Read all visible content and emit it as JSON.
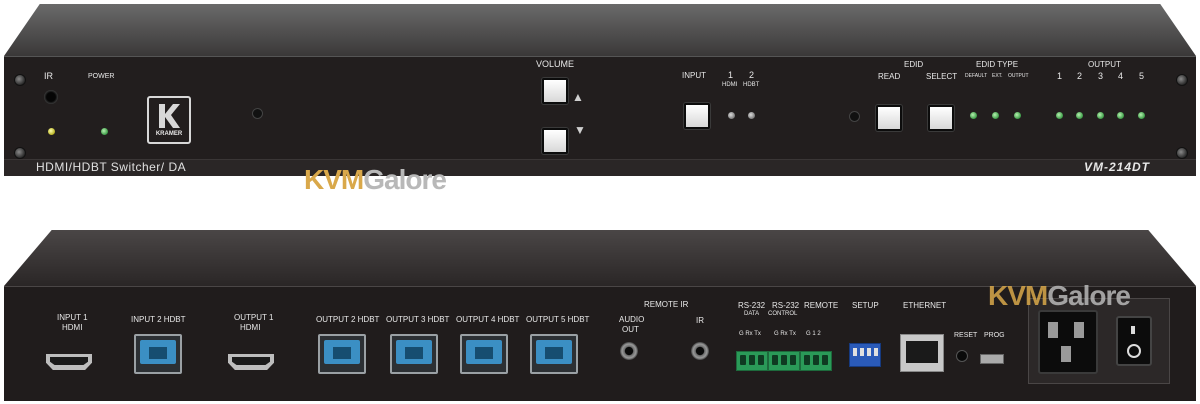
{
  "front_panel": {
    "labels": {
      "ir": "IR",
      "power": "POWER",
      "volume": "VOLUME",
      "input": "INPUT",
      "input_1": "1",
      "input_2": "2",
      "hdmi": "HDMI",
      "hdbt": "HDBT",
      "edid": "EDID",
      "read": "READ",
      "select": "SELECT",
      "edid_type": "EDID TYPE",
      "default": "DEFAULT",
      "ext": "EXT.",
      "output": "OUTPUT",
      "outputs_header": "OUTPUT",
      "output_numbers": [
        "1",
        "2",
        "3",
        "4",
        "5"
      ]
    },
    "logo_text": "KRAMER",
    "product_description": "HDMI/HDBT Switcher/ DA",
    "model": "VM-214DT",
    "arrows": {
      "up": "▲",
      "down": "▼"
    }
  },
  "rear_panel": {
    "labels": {
      "input_1": "INPUT 1",
      "input_1_sub": "HDMI",
      "input_2": "INPUT 2 HDBT",
      "output_1": "OUTPUT 1",
      "output_1_sub": "HDMI",
      "output_2": "OUTPUT 2 HDBT",
      "output_3": "OUTPUT 3 HDBT",
      "output_4": "OUTPUT 4 HDBT",
      "output_5": "OUTPUT 5 HDBT",
      "remote_ir": "REMOTE IR",
      "audio": "AUDIO",
      "audio_sub": "OUT",
      "ir": "IR",
      "rs232_data": "RS-232",
      "rs232_data_sub": "DATA",
      "rs232_control": "RS-232",
      "rs232_control_sub": "CONTROL",
      "remote": "REMOTE",
      "rs232_pins_1": "G  Rx Tx",
      "rs232_pins_2": "G  Rx Tx",
      "remote_pins": "G  1  2",
      "setup": "SETUP",
      "ethernet": "ETHERNET",
      "reset": "RESET",
      "prog": "PROG"
    }
  },
  "watermark": {
    "part1": "KVM",
    "part2": "Galore"
  },
  "colors": {
    "chassis": "#1f1c1c",
    "label_text": "#e8e8e8",
    "led_green": "#3a9a45",
    "led_yellow": "#b6b020",
    "hdbt_port": "#3b8fc4",
    "terminal_block": "#2a9a58",
    "watermark_kvm": "#d9a84a",
    "watermark_galore": "#b8b8b8"
  },
  "icons": [
    "up-arrow-icon",
    "down-arrow-icon",
    "kramer-logo-icon",
    "power-switch-icon"
  ]
}
